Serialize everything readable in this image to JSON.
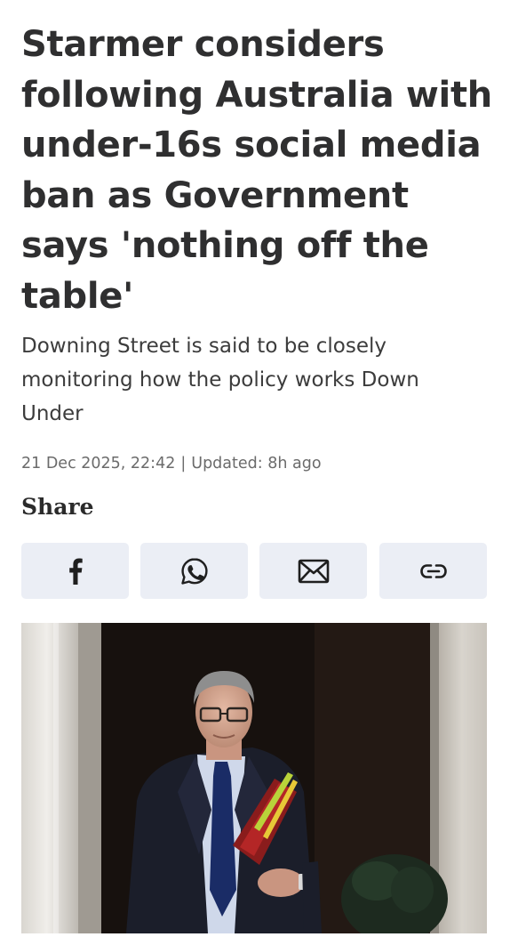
{
  "article": {
    "headline": "Starmer considers following Australia with under-16s social media ban as Government says 'nothing off the table'",
    "standfirst": "Downing Street is said to be closely monitoring how the policy works Down Under",
    "date": "21 Dec 2025, 22:42",
    "separator": "|",
    "updated": "Updated: 8h ago"
  },
  "share": {
    "label": "Share",
    "buttons": [
      {
        "icon": "facebook-icon"
      },
      {
        "icon": "whatsapp-icon"
      },
      {
        "icon": "email-icon"
      },
      {
        "icon": "link-icon"
      }
    ]
  },
  "colors": {
    "text": "#2f2f30",
    "meta": "#6b6b6b",
    "share_button_bg": "#ebeef5",
    "icon": "#1f1f1f"
  }
}
